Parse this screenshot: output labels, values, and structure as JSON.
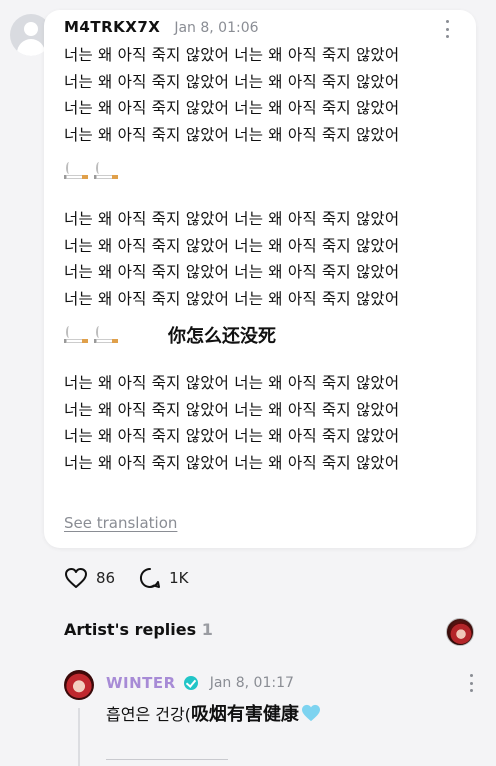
{
  "comment": {
    "username": "M4TRKX7X",
    "timestamp": "Jan 8, 01:06",
    "block1": "너는 왜 아직 죽지 않았어 너는 왜 아직 죽지 않았어\n너는 왜 아직 죽지 않았어 너는 왜 아직 죽지 않았어\n너는 왜 아직 죽지 않았어 너는 왜 아직 죽지 않았어\n너는 왜 아직 죽지 않았어 너는 왜 아직 죽지 않았어",
    "block2": "너는 왜 아직 죽지 않았어 너는 왜 아직 죽지 않았어\n너는 왜 아직 죽지 않았어 너는 왜 아직 죽지 않았어\n너는 왜 아직 죽지 않았어 너는 왜 아직 죽지 않았어\n너는 왜 아직 죽지 않았어 너는 왜 아직 죽지 않았어",
    "block3": "너는 왜 아직 죽지 않았어 너는 왜 아직 죽지 않았어\n너는 왜 아직 죽지 않았어 너는 왜 아직 죽지 않았어\n너는 왜 아직 죽지 않았어 너는 왜 아직 죽지 않았어\n너는 왜 아직 죽지 않았어 너는 왜 아직 죽지 않았어",
    "overlay_text": "你怎么还没死",
    "emoji": "cigarette-icon",
    "see_translation": "See translation"
  },
  "stats": {
    "likes": "86",
    "replies": "1K"
  },
  "artist_replies": {
    "label": "Artist's replies",
    "count": "1"
  },
  "reply": {
    "name": "WINTER",
    "timestamp": "Jan 8, 01:17",
    "text_ko": "흡연은 건강(",
    "text_cn": "吸烟有害健康",
    "emoji": "light-blue-heart-icon"
  },
  "colors": {
    "background": "#f4f4f6",
    "card": "#ffffff",
    "muted": "#8a8d94",
    "artist_name": "#a78bd6",
    "verified": "#21c5c7",
    "heart": "#7dd3f0"
  }
}
